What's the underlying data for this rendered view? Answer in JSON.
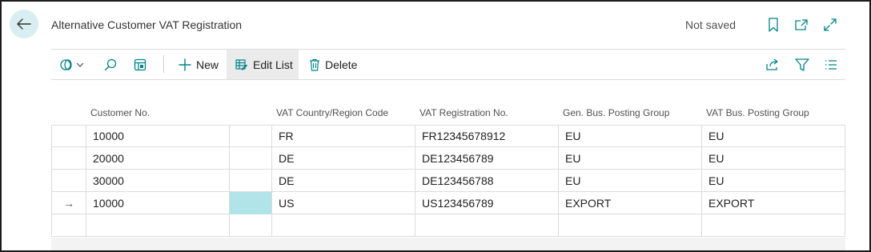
{
  "header": {
    "title": "Alternative Customer VAT Registration",
    "save_status": "Not saved"
  },
  "toolbar": {
    "new_label": "New",
    "edit_list_label": "Edit List",
    "delete_label": "Delete"
  },
  "columns": [
    "Customer No.",
    "VAT Country/Region Code",
    "VAT Registration No.",
    "Gen. Bus. Posting Group",
    "VAT Bus. Posting Group"
  ],
  "rows": [
    {
      "marker": "",
      "customer_no": "10000",
      "country": "FR",
      "vat_no": "FR12345678912",
      "gen_bus": "EU",
      "vat_bus": "EU"
    },
    {
      "marker": "",
      "customer_no": "20000",
      "country": "DE",
      "vat_no": "DE123456789",
      "gen_bus": "EU",
      "vat_bus": "EU"
    },
    {
      "marker": "",
      "customer_no": "30000",
      "country": "DE",
      "vat_no": "DE123456788",
      "gen_bus": "EU",
      "vat_bus": "EU"
    },
    {
      "marker": "→",
      "customer_no": "10000",
      "country": "US",
      "vat_no": "US123456789",
      "gen_bus": "EXPORT",
      "vat_bus": "EXPORT"
    },
    {
      "marker": "",
      "customer_no": "",
      "country": "",
      "vat_no": "",
      "gen_bus": "",
      "vat_bus": ""
    }
  ],
  "colors": {
    "accent": "#008489",
    "back_button_bg": "#d9eef0",
    "selected_cell": "#b1e4e9"
  },
  "icons": [
    "back-arrow-icon",
    "bookmark-icon",
    "open-new-window-icon",
    "expand-icon",
    "views-icon",
    "search-icon",
    "page-icon",
    "plus-icon",
    "edit-list-icon",
    "trash-icon",
    "share-icon",
    "filter-icon",
    "list-icon"
  ]
}
